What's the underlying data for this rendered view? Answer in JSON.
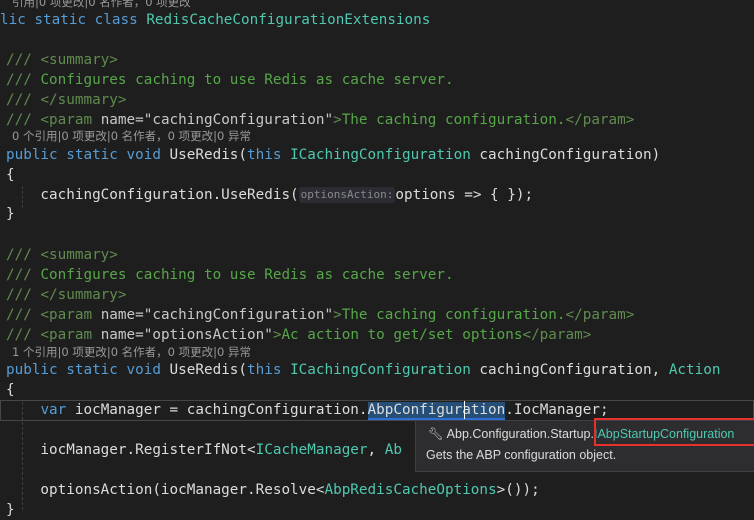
{
  "colors": {
    "background": "#1e1e1e",
    "keyword": "#569cd6",
    "type": "#4ec9b0",
    "comment": "#57a64a",
    "doc_tag": "#608b4e",
    "selection": "#264f78",
    "highlight_box": "#e8302c"
  },
  "lines": [
    {
      "kind": "lens",
      "tokens": [
        {
          "t": "引用|0 项更改|0 名作者，0 项更改",
          "c": "lens"
        }
      ]
    },
    {
      "kind": "code",
      "tokens": [
        {
          "t": "lic static class ",
          "c": "kw"
        },
        {
          "t": "RedisCacheConfigurationExtensions",
          "c": "ty"
        }
      ]
    },
    {
      "kind": "code",
      "tokens": []
    },
    {
      "kind": "code",
      "tokens": [
        {
          "t": "/// <summary>",
          "c": "dt"
        }
      ]
    },
    {
      "kind": "code",
      "tokens": [
        {
          "t": "/// ",
          "c": "dt"
        },
        {
          "t": "Configures caching to use Redis as cache server.",
          "c": "cm"
        }
      ]
    },
    {
      "kind": "code",
      "tokens": [
        {
          "t": "/// </summary>",
          "c": "dt"
        }
      ]
    },
    {
      "kind": "code",
      "tokens": [
        {
          "t": "/// <param ",
          "c": "dt"
        },
        {
          "t": "name=\"cachingConfiguration\"",
          "c": "at"
        },
        {
          "t": ">",
          "c": "dt"
        },
        {
          "t": "The caching configuration.",
          "c": "cm"
        },
        {
          "t": "</param>",
          "c": "dt"
        }
      ]
    },
    {
      "kind": "lens",
      "tokens": [
        {
          "t": "0 个引用|0 项更改|0 名作者，0 项更改|0 异常",
          "c": "lens"
        }
      ]
    },
    {
      "kind": "code",
      "tokens": [
        {
          "t": "public static void ",
          "c": "kw"
        },
        {
          "t": "UseRedis(",
          "c": "tx"
        },
        {
          "t": "this ",
          "c": "kw"
        },
        {
          "t": "ICachingConfiguration",
          "c": "ty"
        },
        {
          "t": " cachingConfiguration)",
          "c": "tx"
        }
      ]
    },
    {
      "kind": "code",
      "tokens": [
        {
          "t": "{",
          "c": "tx"
        }
      ]
    },
    {
      "kind": "code",
      "tokens": [
        {
          "t": "    cachingConfiguration.UseRedis(",
          "c": "tx"
        },
        {
          "t": "optionsAction:",
          "c": "hint"
        },
        {
          "t": "options => { });",
          "c": "tx"
        }
      ]
    },
    {
      "kind": "code",
      "tokens": [
        {
          "t": "}",
          "c": "tx"
        }
      ]
    },
    {
      "kind": "code",
      "tokens": []
    },
    {
      "kind": "code",
      "tokens": [
        {
          "t": "/// <summary>",
          "c": "dt"
        }
      ]
    },
    {
      "kind": "code",
      "tokens": [
        {
          "t": "/// ",
          "c": "dt"
        },
        {
          "t": "Configures caching to use Redis as cache server.",
          "c": "cm"
        }
      ]
    },
    {
      "kind": "code",
      "tokens": [
        {
          "t": "/// </summary>",
          "c": "dt"
        }
      ]
    },
    {
      "kind": "code",
      "tokens": [
        {
          "t": "/// <param ",
          "c": "dt"
        },
        {
          "t": "name=\"cachingConfiguration\"",
          "c": "at"
        },
        {
          "t": ">",
          "c": "dt"
        },
        {
          "t": "The caching configuration.",
          "c": "cm"
        },
        {
          "t": "</param>",
          "c": "dt"
        }
      ]
    },
    {
      "kind": "code",
      "tokens": [
        {
          "t": "/// <param ",
          "c": "dt"
        },
        {
          "t": "name=\"optionsAction\"",
          "c": "at"
        },
        {
          "t": ">",
          "c": "dt"
        },
        {
          "t": "Ac action to get/set options",
          "c": "cm"
        },
        {
          "t": "</param>",
          "c": "dt"
        }
      ]
    },
    {
      "kind": "lens",
      "tokens": [
        {
          "t": "1 个引用|0 项更改|0 名作者，0 项更改|0 异常",
          "c": "lens"
        }
      ]
    },
    {
      "kind": "code",
      "tokens": [
        {
          "t": "public static void ",
          "c": "kw"
        },
        {
          "t": "UseRedis(",
          "c": "tx"
        },
        {
          "t": "this ",
          "c": "kw"
        },
        {
          "t": "ICachingConfiguration",
          "c": "ty"
        },
        {
          "t": " cachingConfiguration, ",
          "c": "tx"
        },
        {
          "t": "Action",
          "c": "ty"
        }
      ]
    },
    {
      "kind": "code",
      "tokens": [
        {
          "t": "{",
          "c": "tx"
        }
      ]
    },
    {
      "kind": "code",
      "tokens": [
        {
          "t": "    ",
          "c": "tx"
        },
        {
          "t": "var",
          "c": "kw"
        },
        {
          "t": " iocManager = cachingConfiguration.",
          "c": "tx"
        },
        {
          "t": "AbpConfiguration",
          "c": "sel"
        },
        {
          "t": ".IocManager;",
          "c": "tx"
        }
      ]
    },
    {
      "kind": "code",
      "tokens": []
    },
    {
      "kind": "code",
      "tokens": [
        {
          "t": "    iocManager.RegisterIfNot<",
          "c": "tx"
        },
        {
          "t": "ICacheManager",
          "c": "ty"
        },
        {
          "t": ", ",
          "c": "tx"
        },
        {
          "t": "Ab",
          "c": "ty"
        }
      ]
    },
    {
      "kind": "code",
      "tokens": []
    },
    {
      "kind": "code",
      "tokens": [
        {
          "t": "    optionsAction(iocManager.Resolve<",
          "c": "tx"
        },
        {
          "t": "AbpRedisCacheOptions",
          "c": "ty"
        },
        {
          "t": ">());",
          "c": "tx"
        }
      ]
    },
    {
      "kind": "code",
      "tokens": [
        {
          "t": "}",
          "c": "tx"
        }
      ]
    }
  ],
  "tooltip": {
    "icon": "wrench-icon",
    "namespace": "Abp.Configuration.Startup.",
    "type": "IAbpStartupConfiguration",
    "description": "Gets the ABP configuration object."
  }
}
